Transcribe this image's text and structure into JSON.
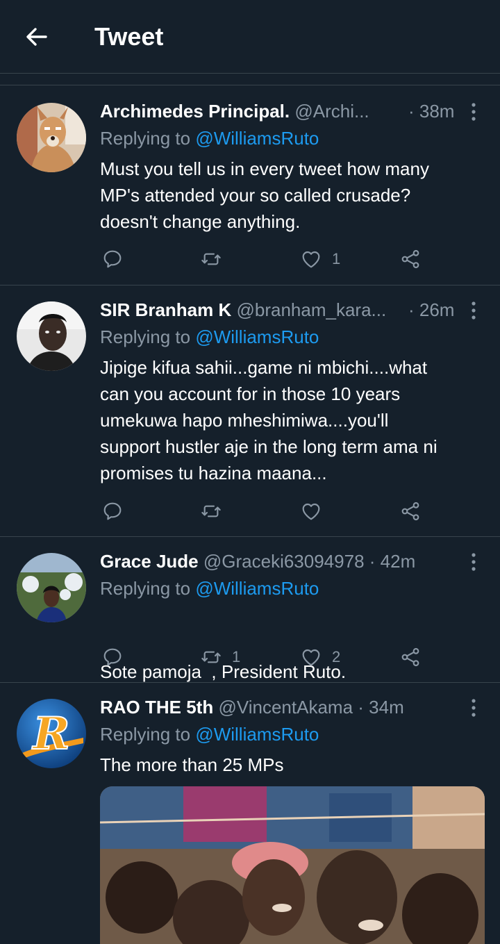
{
  "header": {
    "title": "Tweet"
  },
  "icons": {
    "back": "arrow-left-icon",
    "more": "more-vertical-icon",
    "reply": "reply-icon",
    "retweet": "retweet-icon",
    "like": "heart-icon",
    "share": "share-icon"
  },
  "colors": {
    "background": "#15202b",
    "secondary_text": "#8b98a5",
    "link": "#1d9bf0",
    "divider": "#38444d"
  },
  "replies": [
    {
      "name": "Archimedes Principal.",
      "handle": "@Archi...",
      "time": "· 38m",
      "replying_to_label": "Replying to",
      "replying_to": "@WilliamsRuto",
      "lines": [
        "Must you tell us in every tweet how many",
        "MP's attended your so called crusade?",
        "doesn't change anything."
      ],
      "retweet_count": "",
      "like_count": "1"
    },
    {
      "name": "SIR Branham K",
      "handle": "@branham_kara...",
      "time": "· 26m",
      "replying_to_label": "Replying to",
      "replying_to": "@WilliamsRuto",
      "lines": [
        "Jipige kifua sahii...game ni mbichi....what",
        "can you account for in those 10 years",
        "umekuwa hapo mheshimiwa....you'll",
        "support hustler aje in the long term ama ni",
        "promises tu hazina maana..."
      ],
      "retweet_count": "",
      "like_count": ""
    },
    {
      "name": "Grace Jude",
      "handle": "@Graceki63094978",
      "time": "· 42m",
      "replying_to_label": "Replying to",
      "replying_to": "@WilliamsRuto",
      "lines": [
        "Sote pamoja  , President Ruto."
      ],
      "retweet_count": "1",
      "like_count": "2"
    },
    {
      "name": "RAO THE 5th",
      "handle": "@VincentAkama",
      "time": "· 34m",
      "replying_to_label": "Replying to",
      "replying_to": "@WilliamsRuto",
      "lines": [
        "The more than 25 MPs"
      ],
      "retweet_count": "",
      "like_count": ""
    }
  ]
}
